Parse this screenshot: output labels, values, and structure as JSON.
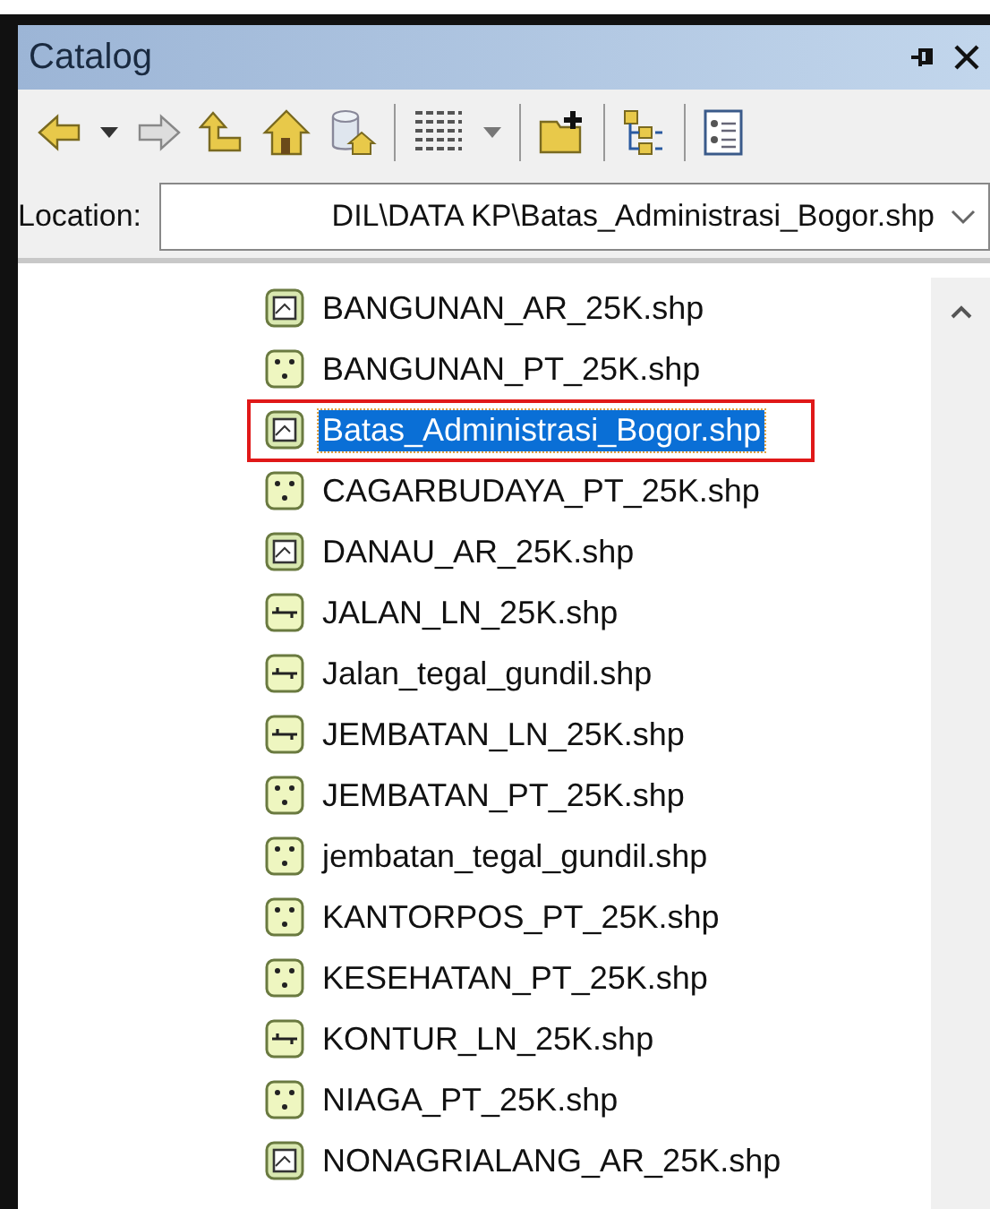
{
  "window": {
    "title": "Catalog"
  },
  "location": {
    "label": "Location:",
    "value": "DIL\\DATA KP\\Batas_Administrasi_Bogor.shp"
  },
  "items": [
    {
      "name": "BANGUNAN_AR_25K.shp",
      "kind": "polygon",
      "selected": false,
      "marked": false
    },
    {
      "name": "BANGUNAN_PT_25K.shp",
      "kind": "point",
      "selected": false,
      "marked": false
    },
    {
      "name": "Batas_Administrasi_Bogor.shp",
      "kind": "polygon",
      "selected": true,
      "marked": true
    },
    {
      "name": "CAGARBUDAYA_PT_25K.shp",
      "kind": "point",
      "selected": false,
      "marked": false
    },
    {
      "name": "DANAU_AR_25K.shp",
      "kind": "polygon",
      "selected": false,
      "marked": false
    },
    {
      "name": "JALAN_LN_25K.shp",
      "kind": "line",
      "selected": false,
      "marked": false
    },
    {
      "name": "Jalan_tegal_gundil.shp",
      "kind": "line",
      "selected": false,
      "marked": false
    },
    {
      "name": "JEMBATAN_LN_25K.shp",
      "kind": "line",
      "selected": false,
      "marked": false
    },
    {
      "name": "JEMBATAN_PT_25K.shp",
      "kind": "point",
      "selected": false,
      "marked": false
    },
    {
      "name": "jembatan_tegal_gundil.shp",
      "kind": "point",
      "selected": false,
      "marked": false
    },
    {
      "name": "KANTORPOS_PT_25K.shp",
      "kind": "point",
      "selected": false,
      "marked": false
    },
    {
      "name": "KESEHATAN_PT_25K.shp",
      "kind": "point",
      "selected": false,
      "marked": false
    },
    {
      "name": "KONTUR_LN_25K.shp",
      "kind": "line",
      "selected": false,
      "marked": false
    },
    {
      "name": "NIAGA_PT_25K.shp",
      "kind": "point",
      "selected": false,
      "marked": false
    },
    {
      "name": "NONAGRIALANG_AR_25K.shp",
      "kind": "polygon",
      "selected": false,
      "marked": false
    }
  ]
}
